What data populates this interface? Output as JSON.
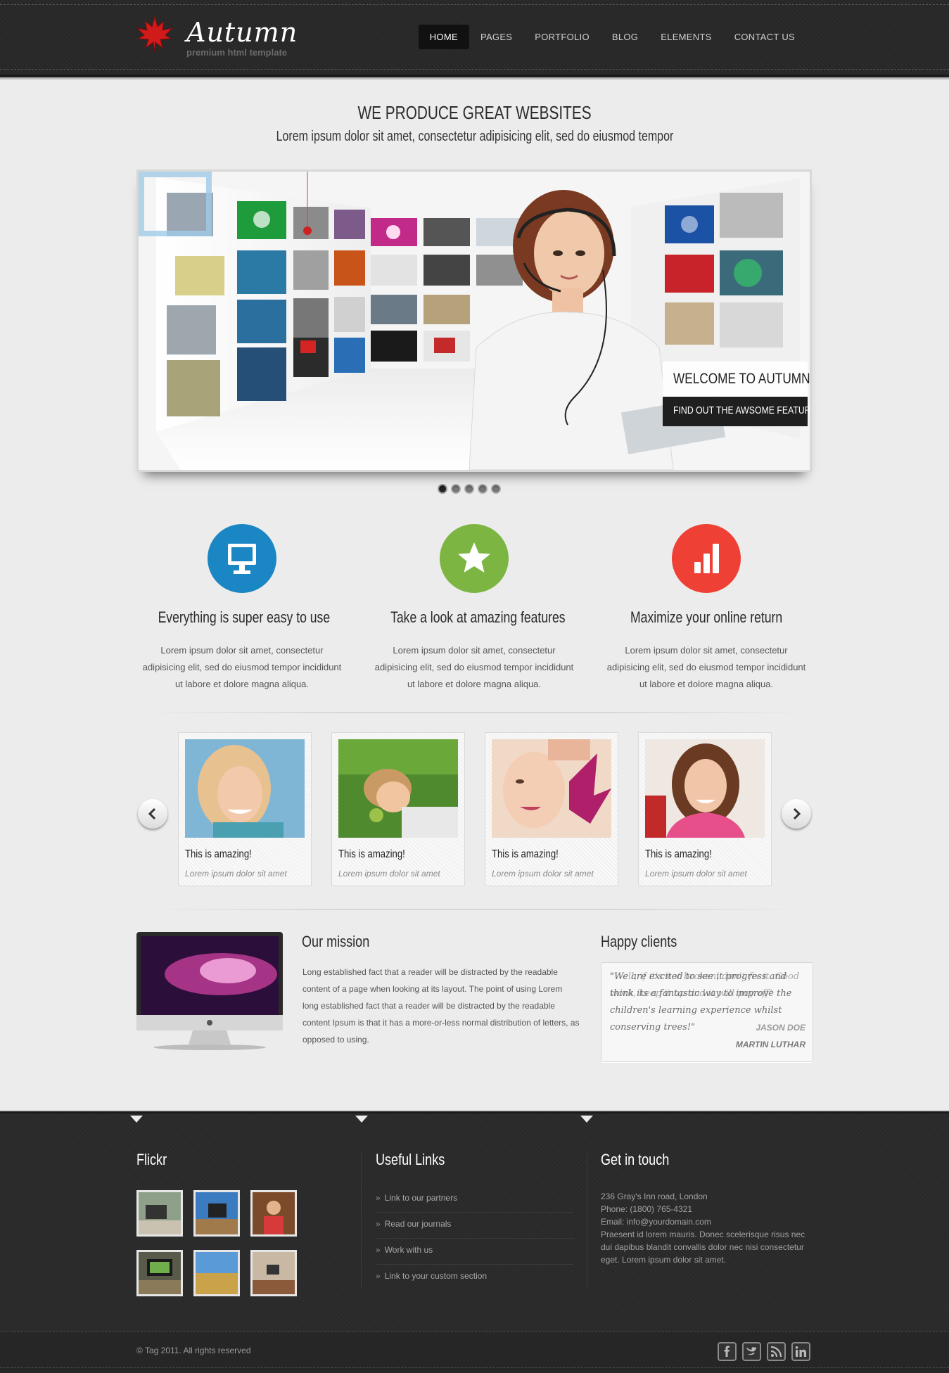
{
  "header": {
    "brand": "Autumn",
    "tagline": "premium html template",
    "nav": [
      "HOME",
      "PAGES",
      "PORTFOLIO",
      "BLOG",
      "ELEMENTS",
      "CONTACT US"
    ]
  },
  "intro": {
    "title": "WE PRODUCE GREAT WEBSITES",
    "subtitle": "Lorem ipsum dolor sit amet, consectetur adipisicing elit, sed do eiusmod tempor"
  },
  "slider": {
    "caption_title": "WELCOME TO AUTUMN",
    "caption_link": "FIND OUT THE AWSOME FEATURES",
    "active_dot": 1,
    "dot_count": 5
  },
  "features": [
    {
      "icon": "monitor-icon",
      "color": "#1a86c4",
      "title": "Everything is super easy to use",
      "text": "Lorem ipsum dolor sit amet, consectetur adipisicing elit, sed do eiusmod tempor incididunt ut labore et dolore magna aliqua."
    },
    {
      "icon": "star-icon",
      "color": "#7db542",
      "title": "Take a look at amazing features",
      "text": "Lorem ipsum dolor sit amet, consectetur adipisicing elit, sed do eiusmod tempor incididunt ut labore et dolore magna aliqua."
    },
    {
      "icon": "bar-chart-icon",
      "color": "#ef4035",
      "title": "Maximize your online return",
      "text": "Lorem ipsum dolor sit amet, consectetur adipisicing elit, sed do eiusmod tempor incididunt ut labore et dolore magna aliqua."
    }
  ],
  "portfolio": [
    {
      "title": "This is amazing!",
      "subtitle": "Lorem ipsum dolor sit amet"
    },
    {
      "title": "This is amazing!",
      "subtitle": "Lorem ipsum dolor sit amet"
    },
    {
      "title": "This is amazing!",
      "subtitle": "Lorem ipsum dolor sit amet"
    },
    {
      "title": "This is amazing!",
      "subtitle": "Lorem ipsum dolor sit amet"
    }
  ],
  "mission": {
    "title": "Our mission",
    "text": "Long established fact that a reader will be distracted by the readable content of a page when looking at its layout. The point of using Lorem long established fact that a reader will be distracted by the readable content Ipsum is that it has a more-or-less normal distribution of letters, as opposed to using."
  },
  "clients": {
    "title": "Happy clients",
    "quote_1": "\"We are excited to see it progress and think its a fantastic way to improve the children's learning experience whilst conserving trees!\"",
    "quote_2": "\"Well, if it's not broken, don't fix it. Good work, keep it up and it will pay off\"",
    "author_1": "JASON DOE",
    "author_2": "MARTIN LUTHAR"
  },
  "footer": {
    "flickr_title": "Flickr",
    "links_title": "Useful Links",
    "links": [
      "Link to our partners",
      "Read our journals",
      "Work with us",
      "Link to your custom section"
    ],
    "contact_title": "Get in touch",
    "address": "236 Gray's Inn road, London",
    "phone": "Phone: (1800) 765-4321",
    "email": "Email: info@yourdomain.com",
    "description": "Praesent id lorem mauris. Donec scelerisque risus nec dui dapibus blandit convallis dolor nec nisi consectetur eget. Lorem ipsum dolor sit amet.",
    "copyright": "© Tag 2011. All rights reserved",
    "social": [
      "facebook-icon",
      "twitter-icon",
      "rss-icon",
      "linkedin-icon"
    ]
  }
}
